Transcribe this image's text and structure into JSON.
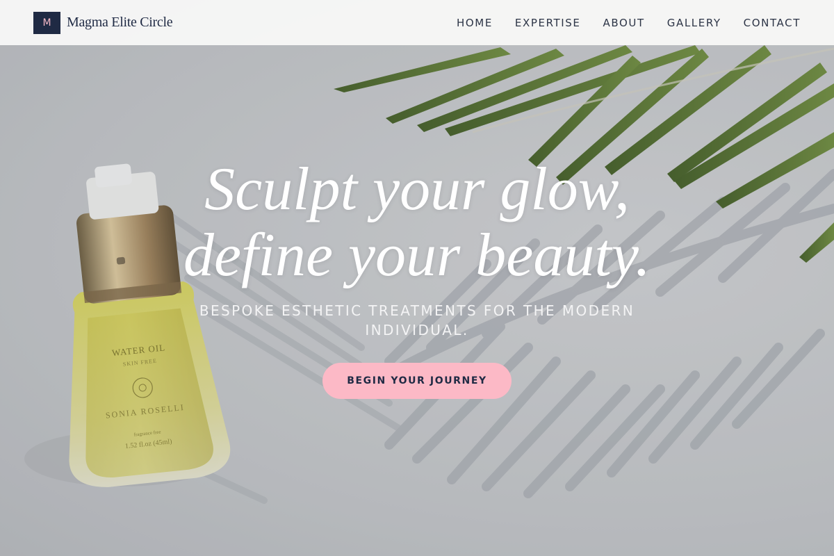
{
  "header": {
    "brand_mark": "M",
    "brand_name": "Magma Elite Circle",
    "nav": [
      "HOME",
      "EXPERTISE",
      "ABOUT",
      "GALLERY",
      "CONTACT"
    ]
  },
  "hero": {
    "headline_line1": "Sculpt your glow,",
    "headline_line2": "define your beauty.",
    "subheadline": "BESPOKE ESTHETIC TREATMENTS FOR THE MODERN INDIVIDUAL.",
    "cta_label": "BEGIN YOUR JOURNEY",
    "bottle": {
      "brand": "SONIA ROSELLI",
      "product": "WATER OIL",
      "note": "SKIN FREE",
      "fragrance": "fragrance free",
      "volume": "1.52 fl.oz (45ml)"
    }
  },
  "colors": {
    "brand_navy": "#1f2a44",
    "accent_pink": "#fcb9c6",
    "header_bg": "#fafaf9",
    "leaf_green": "#4e6b24"
  },
  "icons": {
    "brand_logo": "logo-monogram"
  }
}
